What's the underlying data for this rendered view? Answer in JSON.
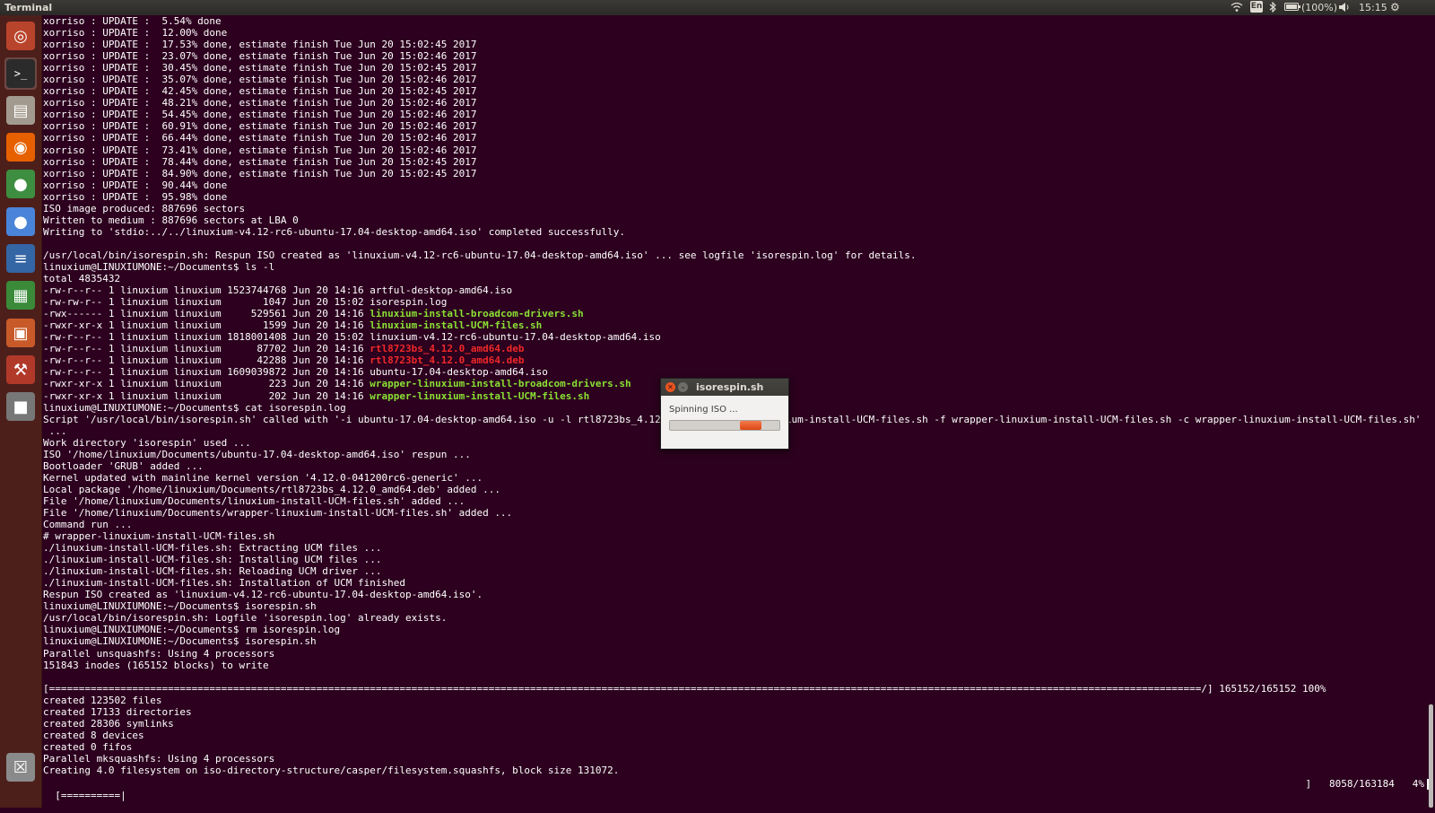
{
  "topbar": {
    "app_title": "Terminal",
    "keyboard_layout": "En",
    "battery_text": "(100%)",
    "clock": "15:15",
    "icons": [
      "wifi-icon",
      "keyboard-icon",
      "bluetooth-icon",
      "battery-icon",
      "volume-icon",
      "settings-gear-icon"
    ]
  },
  "launcher": {
    "items": [
      {
        "name": "ubuntu-dash",
        "glyph": "◎",
        "color": "#b9442c"
      },
      {
        "name": "terminal",
        "glyph": ">_",
        "color": "#2b2b2b"
      },
      {
        "name": "files",
        "glyph": "▤",
        "color": "#a29a8e"
      },
      {
        "name": "firefox",
        "glyph": "◉",
        "color": "#e66000"
      },
      {
        "name": "chrome",
        "glyph": "●",
        "color": "#3e8e41"
      },
      {
        "name": "chromium",
        "glyph": "●",
        "color": "#4a84d8"
      },
      {
        "name": "writer",
        "glyph": "≡",
        "color": "#3465a4"
      },
      {
        "name": "calc",
        "glyph": "▦",
        "color": "#3a8a3a"
      },
      {
        "name": "impress",
        "glyph": "▣",
        "color": "#c85a2a"
      },
      {
        "name": "system-settings",
        "glyph": "⚒",
        "color": "#b1392a"
      },
      {
        "name": "camera",
        "glyph": "■",
        "color": "#777777"
      },
      {
        "name": "trash",
        "glyph": "☒",
        "color": "#8a8a8a"
      }
    ],
    "colors": {
      "background": "#4d1f1b"
    }
  },
  "terminal": {
    "colors": {
      "background": "#2c001e",
      "text": "#ffffff",
      "green": "#8ae234",
      "red": "#ef2929"
    },
    "lines": [
      [
        {
          "t": "xorriso : UPDATE :  5.54% done"
        }
      ],
      [
        {
          "t": "xorriso : UPDATE :  12.00% done"
        }
      ],
      [
        {
          "t": "xorriso : UPDATE :  17.53% done, estimate finish Tue Jun 20 15:02:45 2017"
        }
      ],
      [
        {
          "t": "xorriso : UPDATE :  23.07% done, estimate finish Tue Jun 20 15:02:46 2017"
        }
      ],
      [
        {
          "t": "xorriso : UPDATE :  30.45% done, estimate finish Tue Jun 20 15:02:45 2017"
        }
      ],
      [
        {
          "t": "xorriso : UPDATE :  35.07% done, estimate finish Tue Jun 20 15:02:46 2017"
        }
      ],
      [
        {
          "t": "xorriso : UPDATE :  42.45% done, estimate finish Tue Jun 20 15:02:45 2017"
        }
      ],
      [
        {
          "t": "xorriso : UPDATE :  48.21% done, estimate finish Tue Jun 20 15:02:46 2017"
        }
      ],
      [
        {
          "t": "xorriso : UPDATE :  54.45% done, estimate finish Tue Jun 20 15:02:46 2017"
        }
      ],
      [
        {
          "t": "xorriso : UPDATE :  60.91% done, estimate finish Tue Jun 20 15:02:46 2017"
        }
      ],
      [
        {
          "t": "xorriso : UPDATE :  66.44% done, estimate finish Tue Jun 20 15:02:46 2017"
        }
      ],
      [
        {
          "t": "xorriso : UPDATE :  73.41% done, estimate finish Tue Jun 20 15:02:46 2017"
        }
      ],
      [
        {
          "t": "xorriso : UPDATE :  78.44% done, estimate finish Tue Jun 20 15:02:45 2017"
        }
      ],
      [
        {
          "t": "xorriso : UPDATE :  84.90% done, estimate finish Tue Jun 20 15:02:45 2017"
        }
      ],
      [
        {
          "t": "xorriso : UPDATE :  90.44% done"
        }
      ],
      [
        {
          "t": "xorriso : UPDATE :  95.98% done"
        }
      ],
      [
        {
          "t": "ISO image produced: 887696 sectors"
        }
      ],
      [
        {
          "t": "Written to medium : 887696 sectors at LBA 0"
        }
      ],
      [
        {
          "t": "Writing to 'stdio:../../linuxium-v4.12-rc6-ubuntu-17.04-desktop-amd64.iso' completed successfully."
        }
      ],
      [
        {
          "t": ""
        }
      ],
      [
        {
          "t": "/usr/local/bin/isorespin.sh: Respun ISO created as 'linuxium-v4.12-rc6-ubuntu-17.04-desktop-amd64.iso' ... see logfile 'isorespin.log' for details."
        }
      ],
      [
        {
          "t": "linuxium@LINUXIUMONE:~/Documents$ ls -l"
        }
      ],
      [
        {
          "t": "total 4835432"
        }
      ],
      [
        {
          "t": "-rw-r--r-- 1 linuxium linuxium 1523744768 Jun 20 14:16 artful-desktop-amd64.iso"
        }
      ],
      [
        {
          "t": "-rw-rw-r-- 1 linuxium linuxium       1047 Jun 20 15:02 isorespin.log"
        }
      ],
      [
        {
          "t": "-rwx------ 1 linuxium linuxium     529561 Jun 20 14:16 "
        },
        {
          "t": "linuxium-install-broadcom-drivers.sh",
          "c": "green"
        }
      ],
      [
        {
          "t": "-rwxr-xr-x 1 linuxium linuxium       1599 Jun 20 14:16 "
        },
        {
          "t": "linuxium-install-UCM-files.sh",
          "c": "green"
        }
      ],
      [
        {
          "t": "-rw-r--r-- 1 linuxium linuxium 1818001408 Jun 20 15:02 linuxium-v4.12-rc6-ubuntu-17.04-desktop-amd64.iso"
        }
      ],
      [
        {
          "t": "-rw-r--r-- 1 linuxium linuxium      87702 Jun 20 14:16 "
        },
        {
          "t": "rtl8723bs_4.12.0_amd64.deb",
          "c": "red"
        }
      ],
      [
        {
          "t": "-rw-r--r-- 1 linuxium linuxium      42288 Jun 20 14:16 "
        },
        {
          "t": "rtl8723bt_4.12.0_amd64.deb",
          "c": "red"
        }
      ],
      [
        {
          "t": "-rw-r--r-- 1 linuxium linuxium 1609039872 Jun 20 14:16 ubuntu-17.04-desktop-amd64.iso"
        }
      ],
      [
        {
          "t": "-rwxr-xr-x 1 linuxium linuxium        223 Jun 20 14:16 "
        },
        {
          "t": "wrapper-linuxium-install-broadcom-drivers.sh",
          "c": "green"
        }
      ],
      [
        {
          "t": "-rwxr-xr-x 1 linuxium linuxium        202 Jun 20 14:16 "
        },
        {
          "t": "wrapper-linuxium-install-UCM-files.sh",
          "c": "green"
        }
      ],
      [
        {
          "t": "linuxium@LINUXIUMONE:~/Documents$ cat isorespin.log"
        }
      ],
      [
        {
          "t": "Script '/usr/local/bin/isorespin.sh' called with '-i ubuntu-17.04-desktop-amd64.iso -u -l rtl8723bs_4.12.0_amd64.deb -f linuxium-install-UCM-files.sh -f wrapper-linuxium-install-UCM-files.sh -c wrapper-linuxium-install-UCM-files.sh'"
        }
      ],
      [
        {
          "t": " ..."
        }
      ],
      [
        {
          "t": "Work directory 'isorespin' used ..."
        }
      ],
      [
        {
          "t": "ISO '/home/linuxium/Documents/ubuntu-17.04-desktop-amd64.iso' respun ..."
        }
      ],
      [
        {
          "t": "Bootloader 'GRUB' added ..."
        }
      ],
      [
        {
          "t": "Kernel updated with mainline kernel version '4.12.0-041200rc6-generic' ..."
        }
      ],
      [
        {
          "t": "Local package '/home/linuxium/Documents/rtl8723bs_4.12.0_amd64.deb' added ..."
        }
      ],
      [
        {
          "t": "File '/home/linuxium/Documents/linuxium-install-UCM-files.sh' added ..."
        }
      ],
      [
        {
          "t": "File '/home/linuxium/Documents/wrapper-linuxium-install-UCM-files.sh' added ..."
        }
      ],
      [
        {
          "t": "Command run ..."
        }
      ],
      [
        {
          "t": "# wrapper-linuxium-install-UCM-files.sh"
        }
      ],
      [
        {
          "t": "./linuxium-install-UCM-files.sh: Extracting UCM files ..."
        }
      ],
      [
        {
          "t": "./linuxium-install-UCM-files.sh: Installing UCM files ..."
        }
      ],
      [
        {
          "t": "./linuxium-install-UCM-files.sh: Reloading UCM driver ..."
        }
      ],
      [
        {
          "t": "./linuxium-install-UCM-files.sh: Installation of UCM finished"
        }
      ],
      [
        {
          "t": "Respun ISO created as 'linuxium-v4.12-rc6-ubuntu-17.04-desktop-amd64.iso'."
        }
      ],
      [
        {
          "t": "linuxium@LINUXIUMONE:~/Documents$ isorespin.sh"
        }
      ],
      [
        {
          "t": "/usr/local/bin/isorespin.sh: Logfile 'isorespin.log' already exists."
        }
      ],
      [
        {
          "t": "linuxium@LINUXIUMONE:~/Documents$ rm isorespin.log"
        }
      ],
      [
        {
          "t": "linuxium@LINUXIUMONE:~/Documents$ isorespin.sh"
        }
      ],
      [
        {
          "t": "Parallel unsquashfs: Using 4 processors"
        }
      ],
      [
        {
          "t": "151843 inodes (165152 blocks) to write"
        }
      ],
      [
        {
          "t": ""
        }
      ],
      [
        {
          "t": "[==================================================================================================================================================================================================/] 165152/165152 100%"
        }
      ],
      [
        {
          "t": "created 123502 files"
        }
      ],
      [
        {
          "t": "created 17133 directories"
        }
      ],
      [
        {
          "t": "created 28306 symlinks"
        }
      ],
      [
        {
          "t": "created 8 devices"
        }
      ],
      [
        {
          "t": "created 0 fifos"
        }
      ],
      [
        {
          "t": "Parallel mksquashfs: Using 4 processors"
        }
      ],
      [
        {
          "t": "Creating 4.0 filesystem on iso-directory-structure/casper/filesystem.squashfs, block size 131072."
        }
      ]
    ],
    "status_line": {
      "bar": "[==========|",
      "counts": "]   8058/163184   4%"
    }
  },
  "dialog": {
    "title": "isorespin.sh",
    "message": "Spinning ISO ...",
    "close_glyph": "✕",
    "minimize_glyph": "–",
    "accent": "#dd4814",
    "progress_fraction": 0.2
  }
}
